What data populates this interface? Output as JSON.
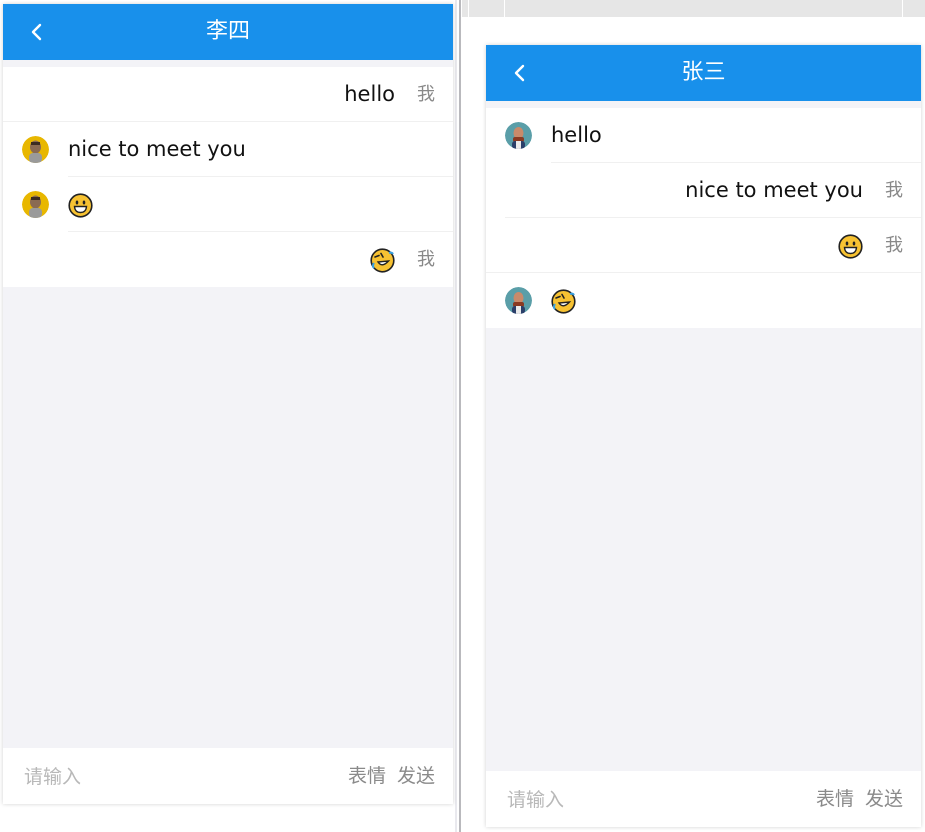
{
  "left_window": {
    "title": "李四",
    "messages": [
      {
        "text": "hello",
        "me_label": "我"
      },
      {
        "text": "nice to meet you"
      },
      {
        "emoji": "grinning-face"
      },
      {
        "emoji": "rolling-on-floor-laughing-face",
        "me_label": "我"
      }
    ],
    "input": {
      "placeholder": "请输入"
    },
    "emoji_button": "表情",
    "send_button": "发送"
  },
  "right_window": {
    "title": "张三",
    "messages": [
      {
        "text": "hello"
      },
      {
        "text": "nice to meet you",
        "me_label": "我"
      },
      {
        "emoji": "grinning-face",
        "me_label": "我"
      },
      {
        "emoji": "rolling-on-floor-laughing-face"
      }
    ],
    "input": {
      "placeholder": "请输入"
    },
    "emoji_button": "表情",
    "send_button": "发送"
  },
  "colors": {
    "header_blue": "#1890eb",
    "background": "#f3f3f7",
    "muted_text": "#888888",
    "emoji_yellow": "#f7c232"
  }
}
